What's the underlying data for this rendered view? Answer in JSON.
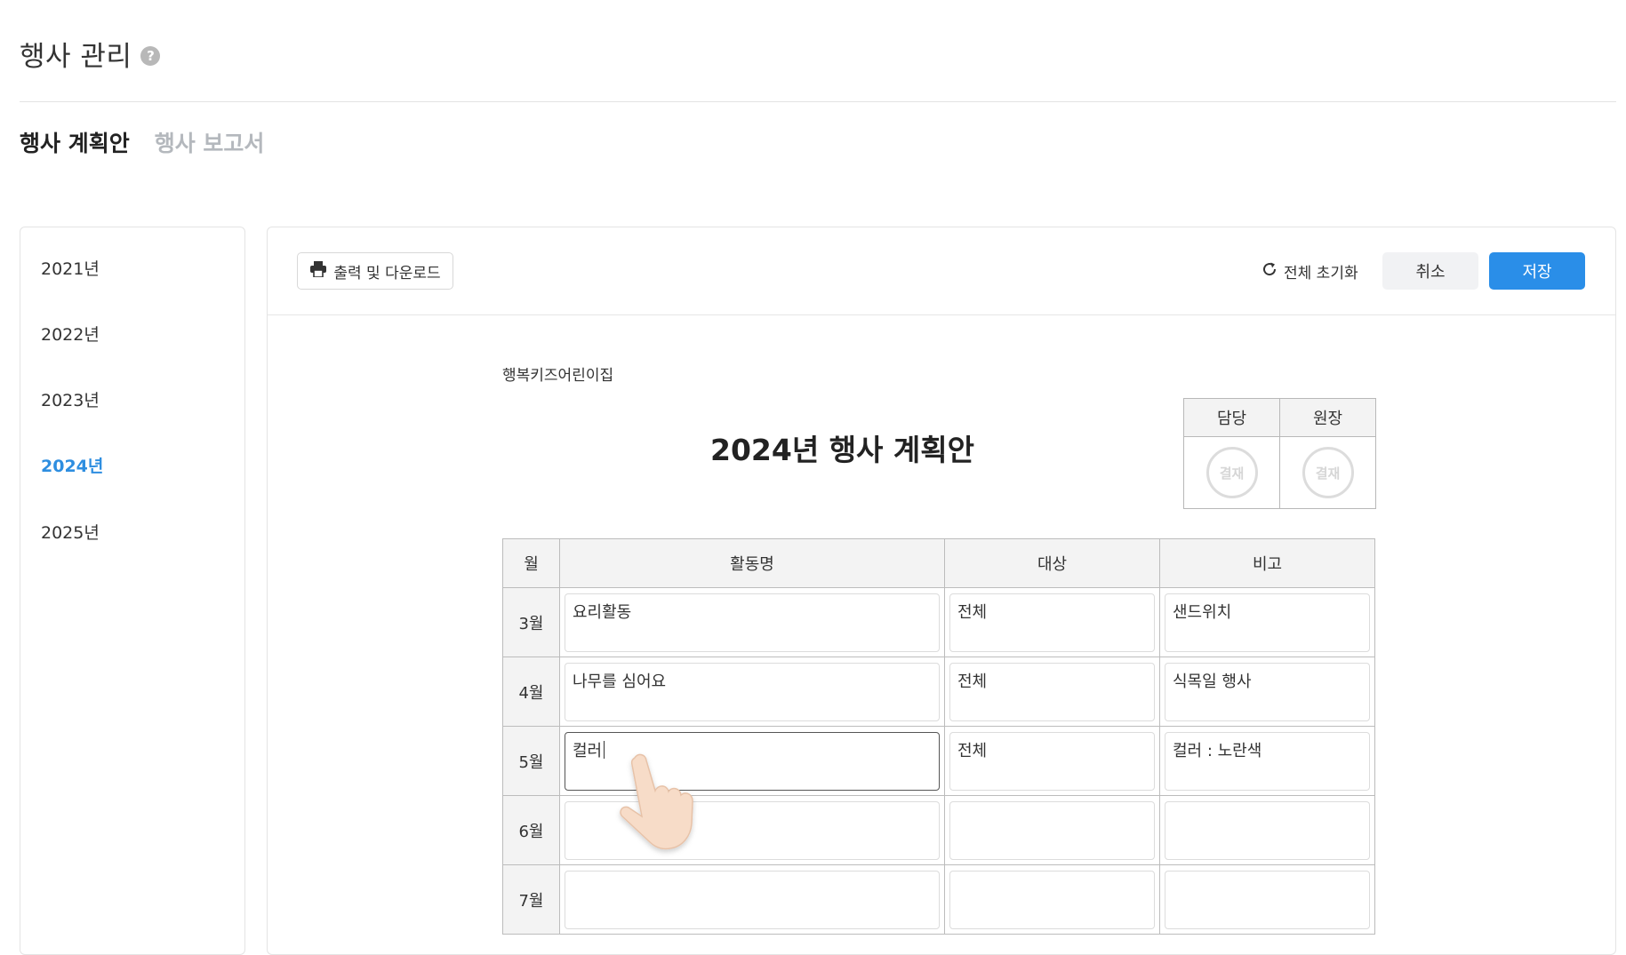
{
  "header": {
    "title": "행사 관리",
    "help_icon": "?"
  },
  "tabs": [
    {
      "label": "행사 계획안",
      "active": true
    },
    {
      "label": "행사 보고서",
      "active": false
    }
  ],
  "sidebar": {
    "years": [
      "2021년",
      "2022년",
      "2023년",
      "2024년",
      "2025년"
    ],
    "selected": "2024년"
  },
  "toolbar": {
    "print_label": "출력 및 다운로드",
    "reset_label": "전체 초기화",
    "cancel_label": "취소",
    "save_label": "저장"
  },
  "document": {
    "organization": "행복키즈어린이집",
    "title": "2024년 행사 계획안",
    "approval": {
      "headers": [
        "담당",
        "원장"
      ],
      "stamp_text": "결재"
    },
    "table": {
      "headers": [
        "월",
        "활동명",
        "대상",
        "비고"
      ],
      "rows": [
        {
          "month": "3월",
          "activity": "요리활동",
          "target": "전체",
          "note": "샌드위치"
        },
        {
          "month": "4월",
          "activity": "나무를 심어요",
          "target": "전체",
          "note": "식목일 행사"
        },
        {
          "month": "5월",
          "activity": "컬러",
          "target": "전체",
          "note": "컬러 : 노란색"
        },
        {
          "month": "6월",
          "activity": "",
          "target": "",
          "note": ""
        },
        {
          "month": "7월",
          "activity": "",
          "target": "",
          "note": ""
        }
      ]
    }
  },
  "colors": {
    "accent": "#2a8ee8",
    "selected_year": "#2e8ee0",
    "inactive_tab": "#b4b8bd"
  }
}
